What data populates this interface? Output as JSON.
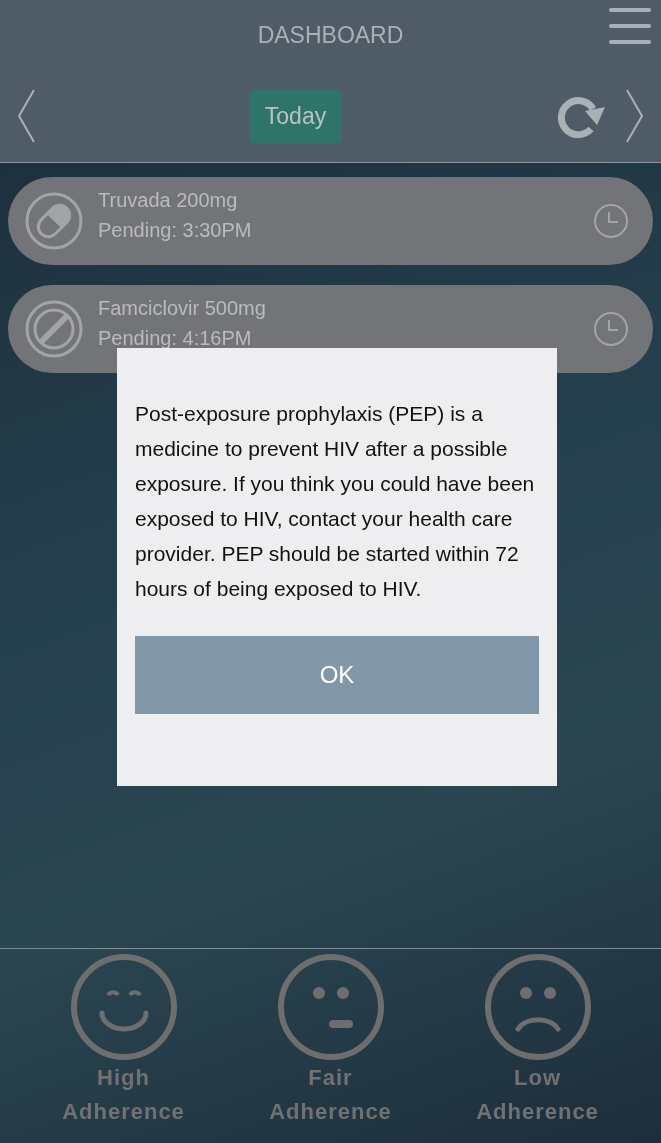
{
  "header": {
    "title": "DASHBOARD"
  },
  "nav": {
    "today_button": "Today"
  },
  "medications": [
    {
      "kind": "pill",
      "name": "Truvada 200mg",
      "status": "Pending: 3:30PM"
    },
    {
      "kind": "blocked",
      "name": "Famciclovir 500mg",
      "status": "Pending: 4:16PM"
    }
  ],
  "dialog": {
    "message": "Post-exposure prophylaxis (PEP) is a medicine to prevent HIV after a possible exposure. If you think you could have been exposed to HIV, contact your health care provider. PEP should be started within 72 hours of being exposed to HIV.",
    "button": "OK"
  },
  "adherence": [
    {
      "kind": "high",
      "line1": "High",
      "line2": "Adherence"
    },
    {
      "kind": "fair",
      "line1": "Fair",
      "line2": "Adherence"
    },
    {
      "kind": "low",
      "line1": "Low",
      "line2": "Adherence"
    }
  ]
}
